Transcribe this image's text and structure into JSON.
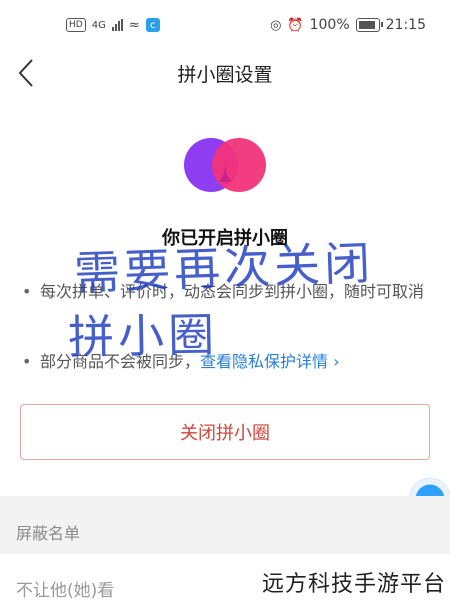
{
  "statusbar": {
    "hd_badge": "HD",
    "network": "4G",
    "battery_percent": "100%",
    "battery_level": 1.0,
    "time": "21:15"
  },
  "navbar": {
    "back_icon": "chevron-left-icon",
    "title": "拼小圈设置"
  },
  "logo": {
    "left_color": "#8e3df0",
    "right_color": "#f2337a"
  },
  "headline": "你已开启拼小圈",
  "bullets": [
    {
      "text": "每次拼单、评价时，动态会同步到拼小圈，随时可取消"
    },
    {
      "text": "部分商品不会被同步，",
      "link": "查看隐私保护详情 ›"
    }
  ],
  "handwriting": {
    "line1": "需要再次关闭",
    "line2": "拼小圈",
    "color": "#1f3cc0"
  },
  "close_button": "关闭拼小圈",
  "section": {
    "header": "屏蔽名单",
    "row_label": "不让他(她)看"
  },
  "watermark": "远方科技手游平台",
  "colors": {
    "accent_red": "#d0453a",
    "link_blue": "#2a7fd4"
  }
}
